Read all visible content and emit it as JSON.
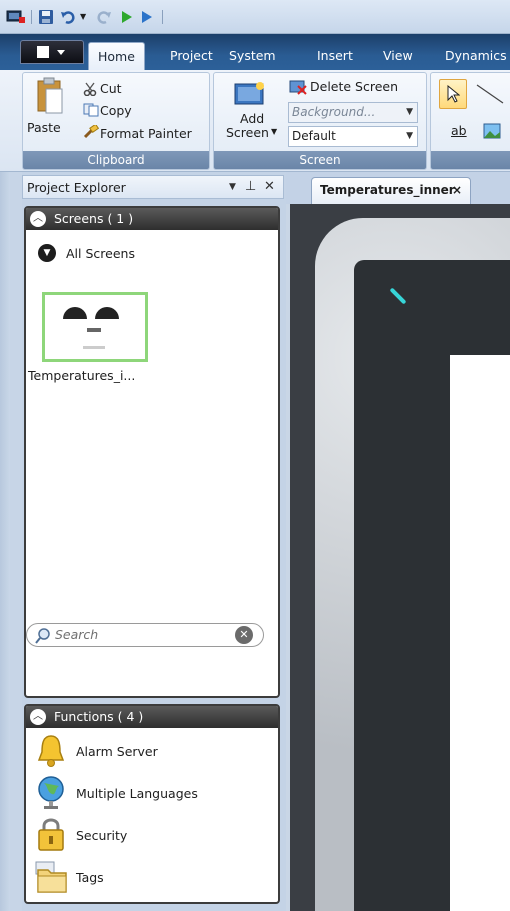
{
  "ribbon": {
    "tabs": [
      {
        "label": "Home",
        "active": true
      },
      {
        "label": "Project"
      },
      {
        "label": "System"
      },
      {
        "label": "Insert"
      },
      {
        "label": "View"
      },
      {
        "label": "Dynamics"
      }
    ],
    "clipboard": {
      "paste": "Paste",
      "cut": "Cut",
      "copy": "Copy",
      "format_painter": "Format Painter",
      "group_label": "Clipboard"
    },
    "screen": {
      "add_screen_line1": "Add",
      "add_screen_line2": "Screen",
      "delete_screen": "Delete Screen",
      "background_placeholder": "Background...",
      "style_value": "Default",
      "group_label": "Screen"
    },
    "objects": {
      "text_label": "ab"
    }
  },
  "project_explorer": {
    "title": "Project Explorer",
    "screens_header": "Screens ( 1 )",
    "all_screens": "All Screens",
    "screen_items": [
      {
        "name": "Temperatures_i..."
      }
    ],
    "search_placeholder": "Search",
    "zoom_level": 0.3,
    "functions_header": "Functions ( 4 )",
    "functions": [
      {
        "label": "Alarm Server",
        "icon": "bell-icon"
      },
      {
        "label": "Multiple Languages",
        "icon": "globe-icon"
      },
      {
        "label": "Security",
        "icon": "lock-icon"
      },
      {
        "label": "Tags",
        "icon": "folder-tags-icon"
      }
    ]
  },
  "document": {
    "active_tab": "Temperatures_inner",
    "close_glyph": "×"
  },
  "colors": {
    "ribbon_tabstrip": "#2a5c93",
    "panel_header": "#3c3c3c",
    "thumbnail_border": "#8ed67a",
    "device_led": "#37d5d8"
  }
}
